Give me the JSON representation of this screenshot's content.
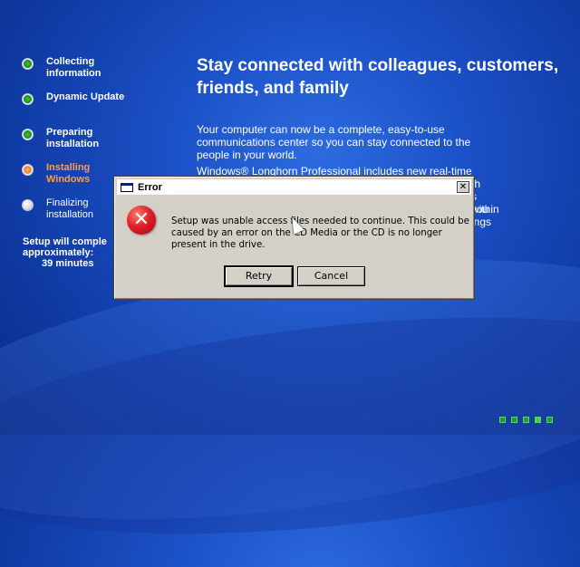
{
  "colors": {
    "background": "#1a4fc4",
    "step_active": "#ff9c4a",
    "dialog_face": "#d4d0c8",
    "progress_dot": "#1f9a3f"
  },
  "steps": [
    {
      "label": "Collecting information",
      "state": "done"
    },
    {
      "label": "Dynamic Update",
      "state": "done"
    },
    {
      "label": "Preparing installation",
      "state": "done"
    },
    {
      "label": "Installing Windows",
      "state": "active"
    },
    {
      "label": "Finalizing installation",
      "state": "pending"
    }
  ],
  "time_info": {
    "line1": "Setup will comple",
    "line2": "approximately:",
    "line3": "39 minutes"
  },
  "headline": "Stay connected with colleagues, customers, friends, and family",
  "body": {
    "para1": "Your computer can now be a complete, easy-to-use communications center so you can stay connected to the people in your world.",
    "para2": "Windows® Longhorn Professional includes new real-time",
    "frag1": "th",
    "frag2": "s you",
    "frag3": "within",
    "frag4": "ings"
  },
  "dialog": {
    "title": "Error",
    "close_label": "✕",
    "message": "Setup was unable access files needed to continue.  This could be caused by an error on the CD Media or the CD is no longer present in the drive.",
    "retry_label": "Retry",
    "cancel_label": "Cancel",
    "icon": "error-icon"
  },
  "progress_dots": 5
}
